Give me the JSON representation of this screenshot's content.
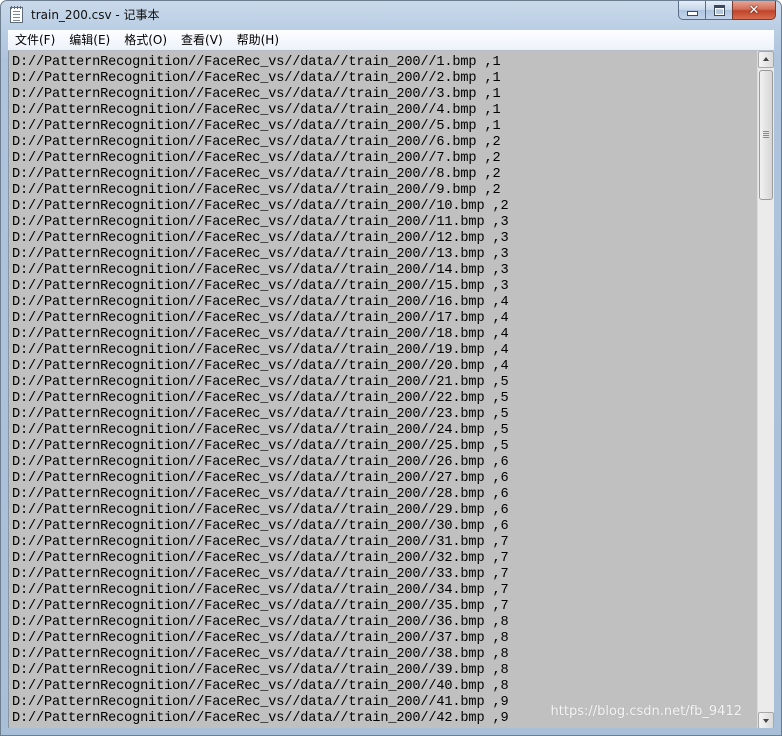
{
  "window": {
    "title": "train_200.csv - 记事本",
    "minimize_glyph": "",
    "close_glyph": "✕"
  },
  "menu": [
    {
      "label": "文件(F)"
    },
    {
      "label": "编辑(E)"
    },
    {
      "label": "格式(O)"
    },
    {
      "label": "查看(V)"
    },
    {
      "label": "帮助(H)"
    }
  ],
  "content": {
    "lines": [
      "D://PatternRecognition//FaceRec_vs//data//train_200//1.bmp ,1",
      "D://PatternRecognition//FaceRec_vs//data//train_200//2.bmp ,1",
      "D://PatternRecognition//FaceRec_vs//data//train_200//3.bmp ,1",
      "D://PatternRecognition//FaceRec_vs//data//train_200//4.bmp ,1",
      "D://PatternRecognition//FaceRec_vs//data//train_200//5.bmp ,1",
      "D://PatternRecognition//FaceRec_vs//data//train_200//6.bmp ,2",
      "D://PatternRecognition//FaceRec_vs//data//train_200//7.bmp ,2",
      "D://PatternRecognition//FaceRec_vs//data//train_200//8.bmp ,2",
      "D://PatternRecognition//FaceRec_vs//data//train_200//9.bmp ,2",
      "D://PatternRecognition//FaceRec_vs//data//train_200//10.bmp ,2",
      "D://PatternRecognition//FaceRec_vs//data//train_200//11.bmp ,3",
      "D://PatternRecognition//FaceRec_vs//data//train_200//12.bmp ,3",
      "D://PatternRecognition//FaceRec_vs//data//train_200//13.bmp ,3",
      "D://PatternRecognition//FaceRec_vs//data//train_200//14.bmp ,3",
      "D://PatternRecognition//FaceRec_vs//data//train_200//15.bmp ,3",
      "D://PatternRecognition//FaceRec_vs//data//train_200//16.bmp ,4",
      "D://PatternRecognition//FaceRec_vs//data//train_200//17.bmp ,4",
      "D://PatternRecognition//FaceRec_vs//data//train_200//18.bmp ,4",
      "D://PatternRecognition//FaceRec_vs//data//train_200//19.bmp ,4",
      "D://PatternRecognition//FaceRec_vs//data//train_200//20.bmp ,4",
      "D://PatternRecognition//FaceRec_vs//data//train_200//21.bmp ,5",
      "D://PatternRecognition//FaceRec_vs//data//train_200//22.bmp ,5",
      "D://PatternRecognition//FaceRec_vs//data//train_200//23.bmp ,5",
      "D://PatternRecognition//FaceRec_vs//data//train_200//24.bmp ,5",
      "D://PatternRecognition//FaceRec_vs//data//train_200//25.bmp ,5",
      "D://PatternRecognition//FaceRec_vs//data//train_200//26.bmp ,6",
      "D://PatternRecognition//FaceRec_vs//data//train_200//27.bmp ,6",
      "D://PatternRecognition//FaceRec_vs//data//train_200//28.bmp ,6",
      "D://PatternRecognition//FaceRec_vs//data//train_200//29.bmp ,6",
      "D://PatternRecognition//FaceRec_vs//data//train_200//30.bmp ,6",
      "D://PatternRecognition//FaceRec_vs//data//train_200//31.bmp ,7",
      "D://PatternRecognition//FaceRec_vs//data//train_200//32.bmp ,7",
      "D://PatternRecognition//FaceRec_vs//data//train_200//33.bmp ,7",
      "D://PatternRecognition//FaceRec_vs//data//train_200//34.bmp ,7",
      "D://PatternRecognition//FaceRec_vs//data//train_200//35.bmp ,7",
      "D://PatternRecognition//FaceRec_vs//data//train_200//36.bmp ,8",
      "D://PatternRecognition//FaceRec_vs//data//train_200//37.bmp ,8",
      "D://PatternRecognition//FaceRec_vs//data//train_200//38.bmp ,8",
      "D://PatternRecognition//FaceRec_vs//data//train_200//39.bmp ,8",
      "D://PatternRecognition//FaceRec_vs//data//train_200//40.bmp ,8",
      "D://PatternRecognition//FaceRec_vs//data//train_200//41.bmp ,9",
      "D://PatternRecognition//FaceRec_vs//data//train_200//42.bmp ,9"
    ]
  },
  "watermark": "https://blog.csdn.net/fb_9412",
  "colors": {
    "editor_background": "#c0c0c0",
    "text": "#000000",
    "close_button": "#c0442a"
  },
  "icons": {
    "app": "notepad-icon",
    "minimize": "minimize-icon",
    "maximize": "maximize-icon",
    "close": "close-icon",
    "scroll_up": "arrow-up-icon",
    "scroll_down": "arrow-down-icon"
  }
}
